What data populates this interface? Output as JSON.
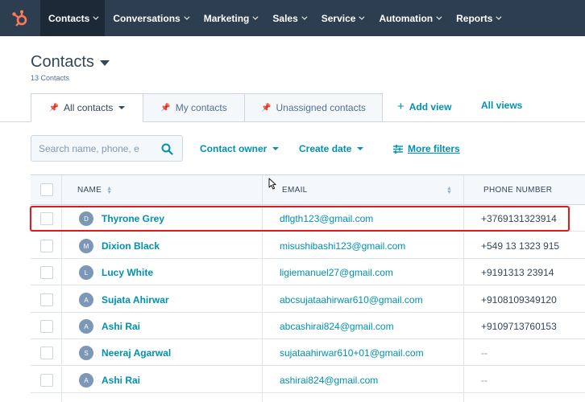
{
  "nav": {
    "items": [
      {
        "label": "Contacts",
        "active": true
      },
      {
        "label": "Conversations",
        "active": false
      },
      {
        "label": "Marketing",
        "active": false
      },
      {
        "label": "Sales",
        "active": false
      },
      {
        "label": "Service",
        "active": false
      },
      {
        "label": "Automation",
        "active": false
      },
      {
        "label": "Reports",
        "active": false
      }
    ]
  },
  "header": {
    "title": "Contacts",
    "count": "13 Contacts"
  },
  "tabs": {
    "all": "All contacts",
    "mine": "My contacts",
    "unassigned": "Unassigned contacts",
    "add_view": "Add view",
    "all_views": "All views"
  },
  "filters": {
    "search_placeholder": "Search name, phone, e",
    "contact_owner": "Contact owner",
    "create_date": "Create date",
    "more_filters": "More filters"
  },
  "table": {
    "columns": {
      "name": "NAME",
      "email": "EMAIL",
      "phone": "PHONE NUMBER"
    },
    "rows": [
      {
        "initial": "D",
        "name": "Thyrone Grey",
        "email": "dflgth123@gmail.com",
        "phone": "+3769131323914"
      },
      {
        "initial": "M",
        "name": "Dixion Black",
        "email": "misushibashi123@gmail.com",
        "phone": "+549 13 1323 915"
      },
      {
        "initial": "L",
        "name": "Lucy White",
        "email": "ligiemanuel27@gmail.com",
        "phone": "+9191313 23914"
      },
      {
        "initial": "A",
        "name": "Sujata Ahirwar",
        "email": "abcsujataahirwar610@gmail.com",
        "phone": "+9108109349120"
      },
      {
        "initial": "A",
        "name": "Ashi Rai",
        "email": "abcashirai824@gmail.com",
        "phone": "+9109713760153"
      },
      {
        "initial": "S",
        "name": "Neeraj Agarwal",
        "email": "sujataahirwar610+01@gmail.com",
        "phone": "--"
      },
      {
        "initial": "A",
        "name": "Ashi Rai",
        "email": "ashirai824@gmail.com",
        "phone": "--"
      }
    ]
  },
  "colors": {
    "nav_bg": "#2d3e50",
    "accent": "#0091ae",
    "logo": "#ff7a59",
    "highlight": "#e3191b"
  }
}
